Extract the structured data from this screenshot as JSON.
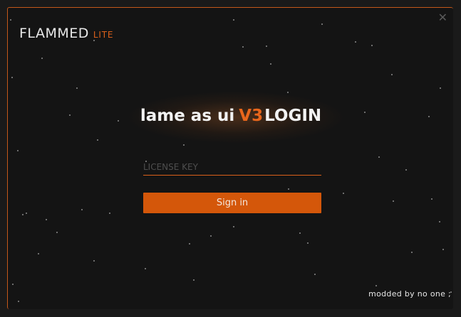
{
  "window": {
    "brand": {
      "name": "FLAMMED",
      "edition": "LITE"
    },
    "close_icon": "close-icon",
    "title": {
      "prefix": "lame as ui",
      "version": "V3",
      "suffix": "LOGIN"
    },
    "license_field": {
      "value": "",
      "placeholder": "LICENSE KEY"
    },
    "signin_button": {
      "label": "Sign in"
    },
    "footer": "modded by no one ;"
  },
  "colors": {
    "accent": "#d4570a",
    "background": "#141414"
  }
}
